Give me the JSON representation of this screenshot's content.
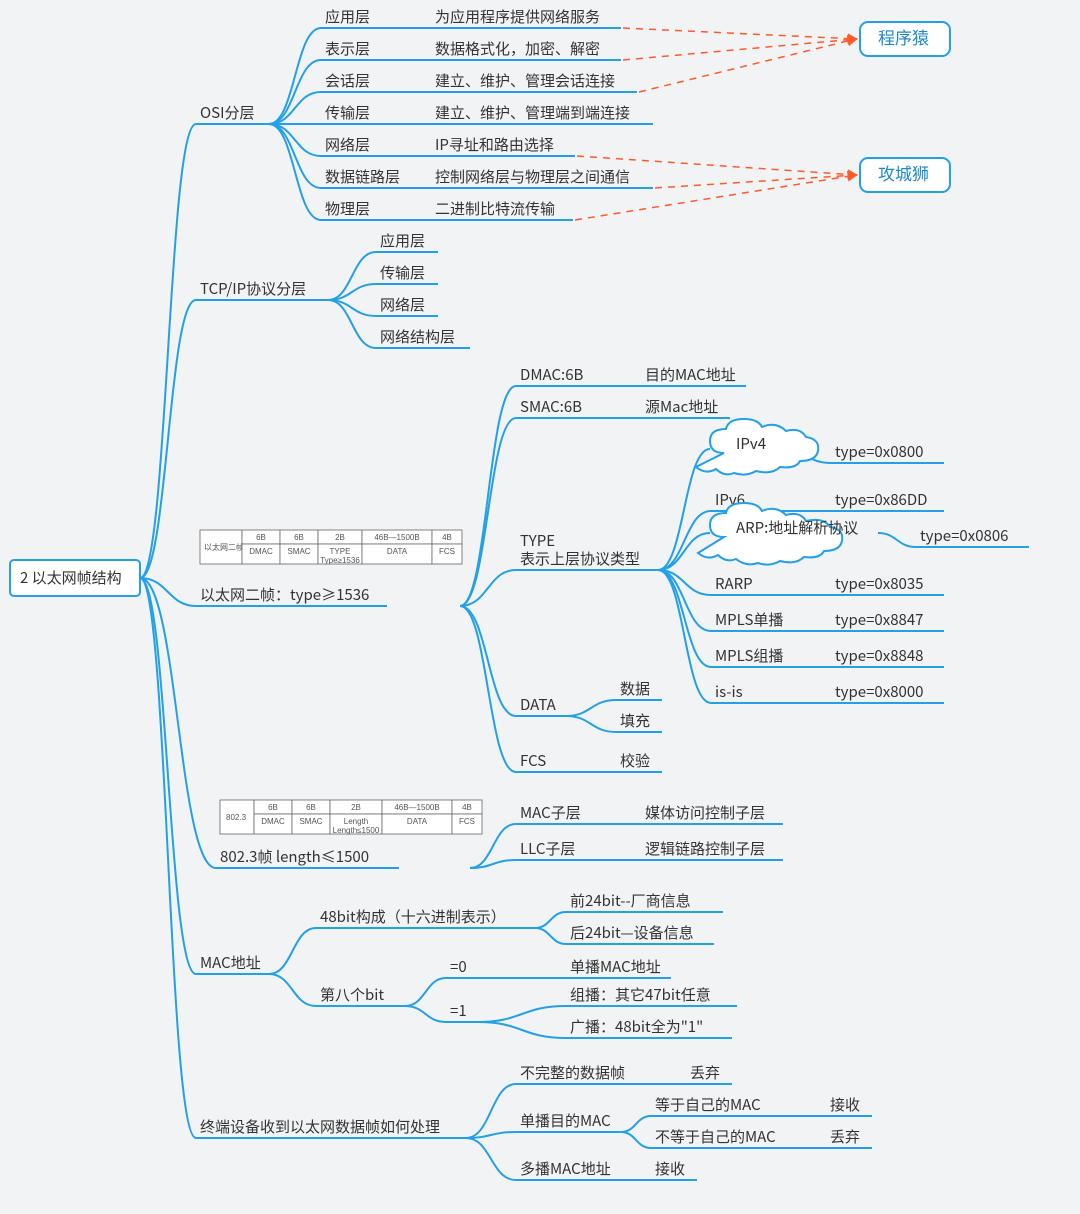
{
  "root": "2 以太网帧结构",
  "osi": {
    "label": "OSI分层",
    "layers": [
      {
        "name": "应用层",
        "desc": "为应用程序提供网络服务"
      },
      {
        "name": "表示层",
        "desc": "数据格式化，加密、解密"
      },
      {
        "name": "会话层",
        "desc": "建立、维护、管理会话连接"
      },
      {
        "name": "传输层",
        "desc": "建立、维护、管理端到端连接"
      },
      {
        "name": "网络层",
        "desc": "IP寻址和路由选择"
      },
      {
        "name": "数据链路层",
        "desc": "控制网络层与物理层之间通信"
      },
      {
        "name": "物理层",
        "desc": "二进制比特流传输"
      }
    ],
    "tags": {
      "top": "程序猿",
      "bottom": "攻城狮"
    }
  },
  "tcpip": {
    "label": "TCP/IP协议分层",
    "layers": [
      "应用层",
      "传输层",
      "网络层",
      "网络结构层"
    ]
  },
  "eth2": {
    "caption": "以太网二帧：type≥1536",
    "table": {
      "row": "以太网二帧",
      "cols": [
        "6B",
        "6B",
        "2B",
        "46B—1500B",
        "4B"
      ],
      "fields": [
        "DMAC",
        "SMAC",
        "TYPE\nType≥1536",
        "DATA",
        "FCS"
      ]
    },
    "fields": [
      {
        "name": "DMAC:6B",
        "desc": "目的MAC地址"
      },
      {
        "name": "SMAC:6B",
        "desc": "源Mac地址"
      }
    ],
    "type": {
      "label": "TYPE",
      "sub": "表示上层协议类型",
      "items": [
        {
          "name": "IPv4",
          "val": "type=0x0800",
          "cloud": true
        },
        {
          "name": "IPv6",
          "val": "type=0x86DD"
        },
        {
          "name": "ARP:地址解析协议",
          "val": "type=0x0806",
          "cloud": true
        },
        {
          "name": "RARP",
          "val": "type=0x8035"
        },
        {
          "name": "MPLS单播",
          "val": "type=0x8847"
        },
        {
          "name": "MPLS组播",
          "val": "type=0x8848"
        },
        {
          "name": "is-is",
          "val": "type=0x8000"
        }
      ]
    },
    "data": {
      "label": "DATA",
      "items": [
        "数据",
        "填充"
      ]
    },
    "fcs": {
      "label": "FCS",
      "desc": "校验"
    }
  },
  "ieee": {
    "caption": "802.3帧 length≤1500",
    "table": {
      "row": "802.3",
      "cols": [
        "6B",
        "6B",
        "2B",
        "46B—1500B",
        "4B"
      ],
      "fields": [
        "DMAC",
        "SMAC",
        "Length\nLength≤1500",
        "DATA",
        "FCS"
      ]
    },
    "items": [
      {
        "name": "MAC子层",
        "desc": "媒体访问控制子层"
      },
      {
        "name": "LLC子层",
        "desc": "逻辑链路控制子层"
      }
    ]
  },
  "mac": {
    "label": "MAC地址",
    "bits": {
      "label": "48bit构成（十六进制表示）",
      "items": [
        "前24bit--厂商信息",
        "后24bit—设备信息"
      ]
    },
    "eighth": {
      "label": "第八个bit",
      "zero": {
        "k": "=0",
        "v": "单播MAC地址"
      },
      "one": {
        "k": "=1",
        "items": [
          "组播：其它47bit任意",
          "广播：48bit全为\"1\""
        ]
      }
    }
  },
  "recv": {
    "label": "终端设备收到以太网数据帧如何处理",
    "items": [
      {
        "name": "不完整的数据帧",
        "desc": "丢弃"
      },
      {
        "name": "单播目的MAC",
        "sub": [
          {
            "name": "等于自己的MAC",
            "desc": "接收"
          },
          {
            "name": "不等于自己的MAC",
            "desc": "丢弃"
          }
        ]
      },
      {
        "name": "多播MAC地址",
        "desc": "接收"
      }
    ]
  }
}
